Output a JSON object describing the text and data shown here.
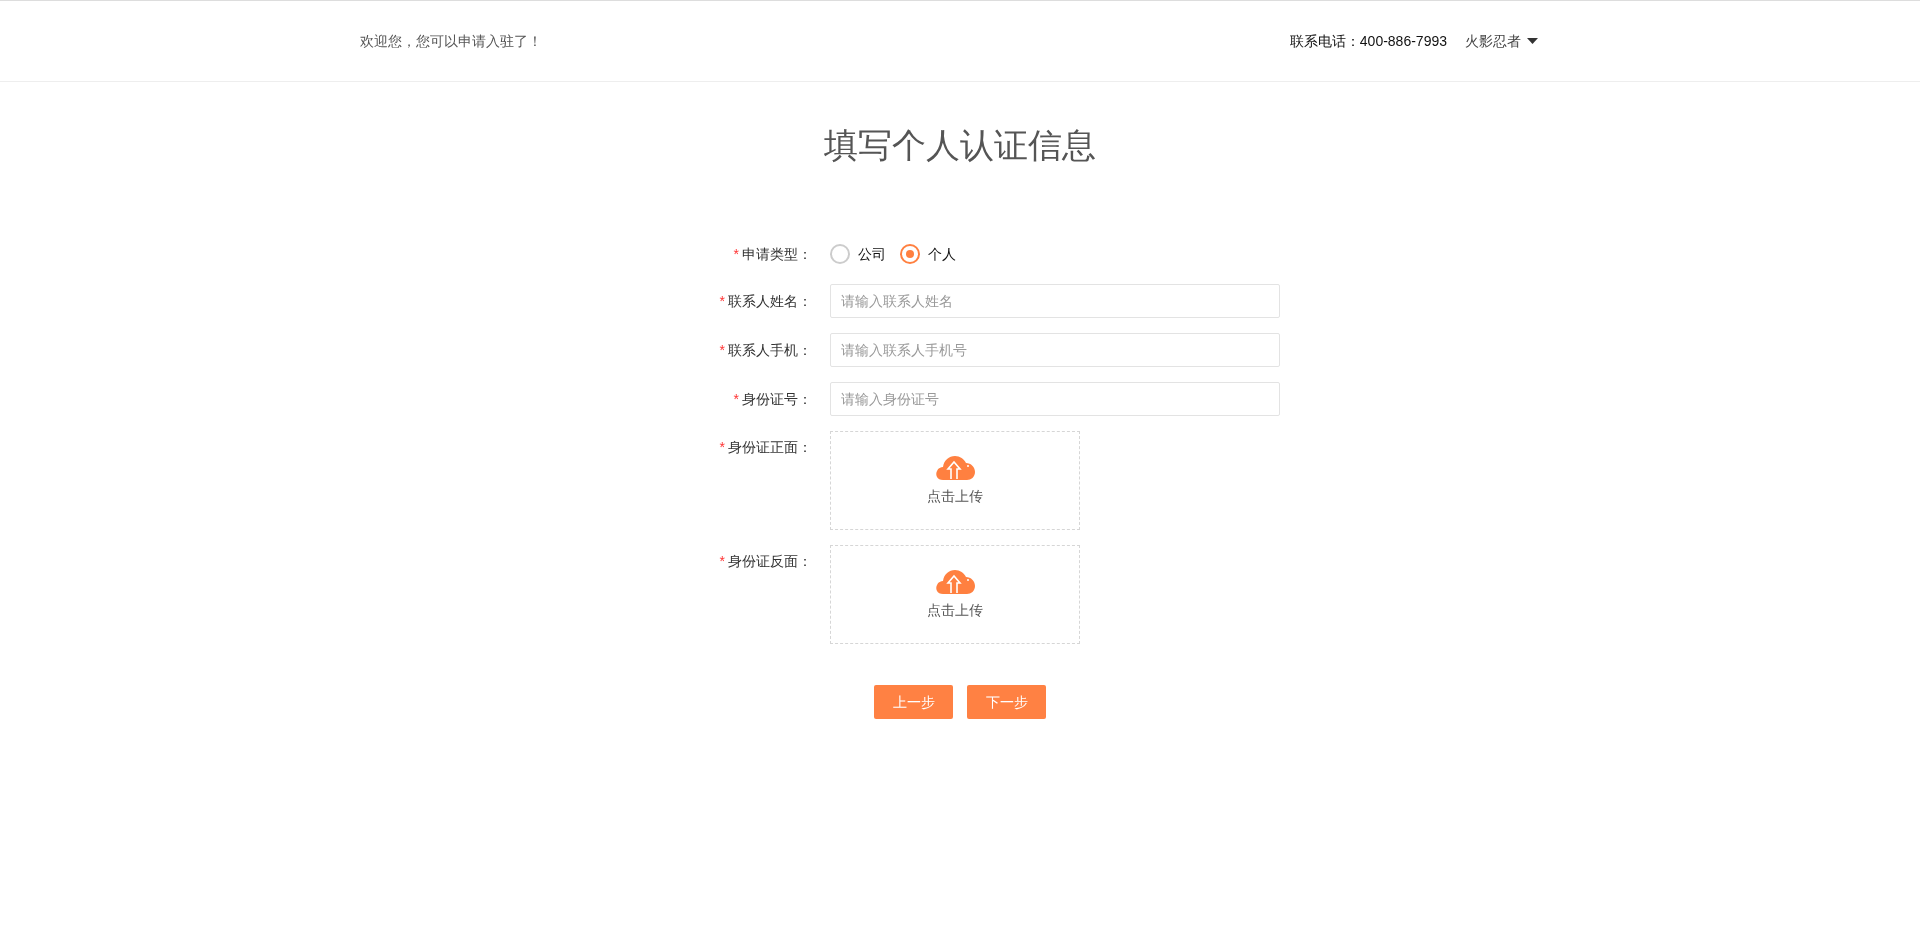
{
  "header": {
    "welcome": "欢迎您，您可以申请入驻了！",
    "phone": "联系电话：400-886-7993",
    "user": "火影忍者"
  },
  "title": "填写个人认证信息",
  "form": [
    {
      "kind": "radio",
      "mark": "*",
      "label": "申请类型：",
      "options": [
        {
          "label": "公司",
          "selected": false
        },
        {
          "label": "个人",
          "selected": true
        }
      ]
    },
    {
      "kind": "input",
      "mark": "*",
      "label": "联系人姓名：",
      "placeholder": "请输入联系人姓名"
    },
    {
      "kind": "input",
      "mark": "*",
      "label": "联系人手机：",
      "placeholder": "请输入联系人手机号"
    },
    {
      "kind": "input",
      "mark": "*",
      "label": "身份证号：",
      "placeholder": "请输入身份证号"
    },
    {
      "kind": "upload",
      "mark": "*",
      "label": "身份证正面：",
      "text": "点击上传"
    },
    {
      "kind": "upload",
      "mark": "*",
      "label": "身份证反面：",
      "text": "点击上传"
    }
  ],
  "buttons": [
    "上一步",
    "下一步"
  ]
}
